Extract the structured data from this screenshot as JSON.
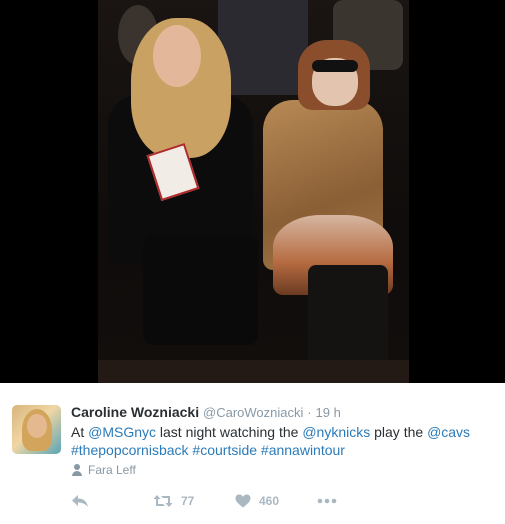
{
  "tweet": {
    "author": {
      "fullname": "Caroline Wozniacki",
      "handle": "@CaroWozniacki",
      "separator": "·",
      "time": "19 h"
    },
    "text": {
      "t1": "At ",
      "m1": "@MSGnyc",
      "t2": " last night watching the ",
      "m2": "@nyknicks",
      "t3": " play the ",
      "m3": "@cavs",
      "h1": "#thepopcornisback",
      "h2": "#courtside",
      "h3": "#annawintour"
    },
    "tagged_person": "Fara Leff",
    "actions": {
      "retweet_count": "77",
      "like_count": "460"
    }
  },
  "icons": [
    "reply-icon",
    "retweet-icon",
    "heart-icon",
    "more-icon",
    "person-icon"
  ],
  "colors": {
    "link": "#2b7bb9",
    "meta": "#8899a6",
    "action": "#aab8c2",
    "text": "#292f33"
  }
}
